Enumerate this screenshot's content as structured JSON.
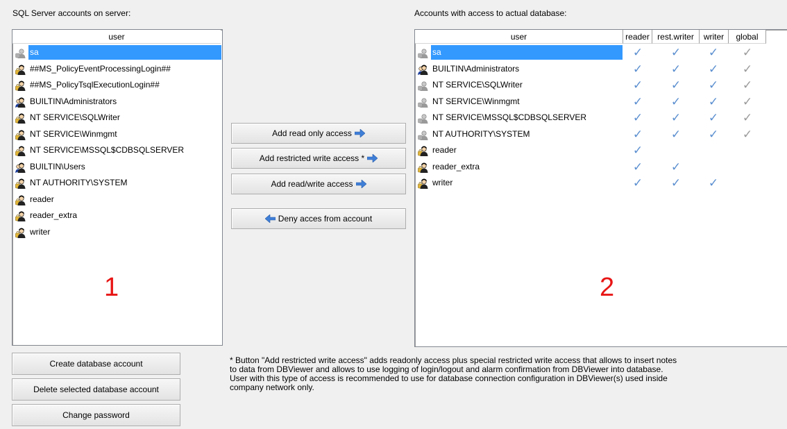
{
  "left_panel": {
    "title": "SQL Server accounts on server:",
    "column_header": "user",
    "big_number": "1",
    "rows": [
      {
        "name": "sa",
        "icon": "user-gray-icon",
        "selected": true
      },
      {
        "name": "##MS_PolicyEventProcessingLogin##",
        "icon": "user-lock-icon"
      },
      {
        "name": "##MS_PolicyTsqlExecutionLogin##",
        "icon": "user-lock-icon"
      },
      {
        "name": "BUILTIN\\Administrators",
        "icon": "user-group-icon"
      },
      {
        "name": "NT SERVICE\\SQLWriter",
        "icon": "user-lock-icon"
      },
      {
        "name": "NT SERVICE\\Winmgmt",
        "icon": "user-lock-icon"
      },
      {
        "name": "NT SERVICE\\MSSQL$CDBSQLSERVER",
        "icon": "user-lock-icon"
      },
      {
        "name": "BUILTIN\\Users",
        "icon": "user-group-icon"
      },
      {
        "name": "NT AUTHORITY\\SYSTEM",
        "icon": "user-lock-icon"
      },
      {
        "name": "reader",
        "icon": "user-key-icon"
      },
      {
        "name": "reader_extra",
        "icon": "user-key-icon"
      },
      {
        "name": "writer",
        "icon": "user-key-icon"
      }
    ]
  },
  "right_panel": {
    "title": "Accounts with access to actual database:",
    "columns": [
      "user",
      "reader",
      "rest.writer",
      "writer",
      "global"
    ],
    "big_number": "2",
    "rows": [
      {
        "name": "sa",
        "icon": "user-gray-icon",
        "selected": true,
        "reader": true,
        "rest_writer": true,
        "writer": true,
        "global": "gray"
      },
      {
        "name": "BUILTIN\\Administrators",
        "icon": "user-group-icon",
        "reader": true,
        "rest_writer": true,
        "writer": true,
        "global": "gray"
      },
      {
        "name": "NT SERVICE\\SQLWriter",
        "icon": "user-gray-icon",
        "reader": true,
        "rest_writer": true,
        "writer": true,
        "global": "gray"
      },
      {
        "name": "NT SERVICE\\Winmgmt",
        "icon": "user-gray-icon",
        "reader": true,
        "rest_writer": true,
        "writer": true,
        "global": "gray"
      },
      {
        "name": "NT SERVICE\\MSSQL$CDBSQLSERVER",
        "icon": "user-gray-icon",
        "reader": true,
        "rest_writer": true,
        "writer": true,
        "global": "gray"
      },
      {
        "name": "NT AUTHORITY\\SYSTEM",
        "icon": "user-gray-icon",
        "reader": true,
        "rest_writer": true,
        "writer": true,
        "global": "gray"
      },
      {
        "name": "reader",
        "icon": "user-key-icon",
        "reader": true,
        "rest_writer": false,
        "writer": false,
        "global": false
      },
      {
        "name": "reader_extra",
        "icon": "user-key-icon",
        "reader": true,
        "rest_writer": true,
        "writer": false,
        "global": false
      },
      {
        "name": "writer",
        "icon": "user-key-icon",
        "reader": true,
        "rest_writer": true,
        "writer": true,
        "global": false
      }
    ]
  },
  "middle_buttons": {
    "add_read_only": "Add read only access",
    "add_restricted_write": "Add restricted write access *",
    "add_read_write": "Add read/write access",
    "deny_access": "Deny acces from account"
  },
  "bottom_buttons": {
    "create": "Create database account",
    "delete": "Delete selected database account",
    "change_password": "Change password"
  },
  "note_lines": [
    "* Button \"Add restricted write access\" adds readonly access plus special restricted write access that allows to insert notes",
    "to data from DBViewer and allows to use logging of login/logout and alarm confirmation from DBViewer into database.",
    "User with this type of access is recommended to use for database connection configuration in DBViewer(s) used inside",
    "company network only."
  ],
  "colors": {
    "selection": "#3399ff",
    "check_blue": "#5b8fd0",
    "check_gray": "#9a9a9a",
    "annotation_red": "#e81515",
    "arrow_blue": "#3f7fd8"
  }
}
